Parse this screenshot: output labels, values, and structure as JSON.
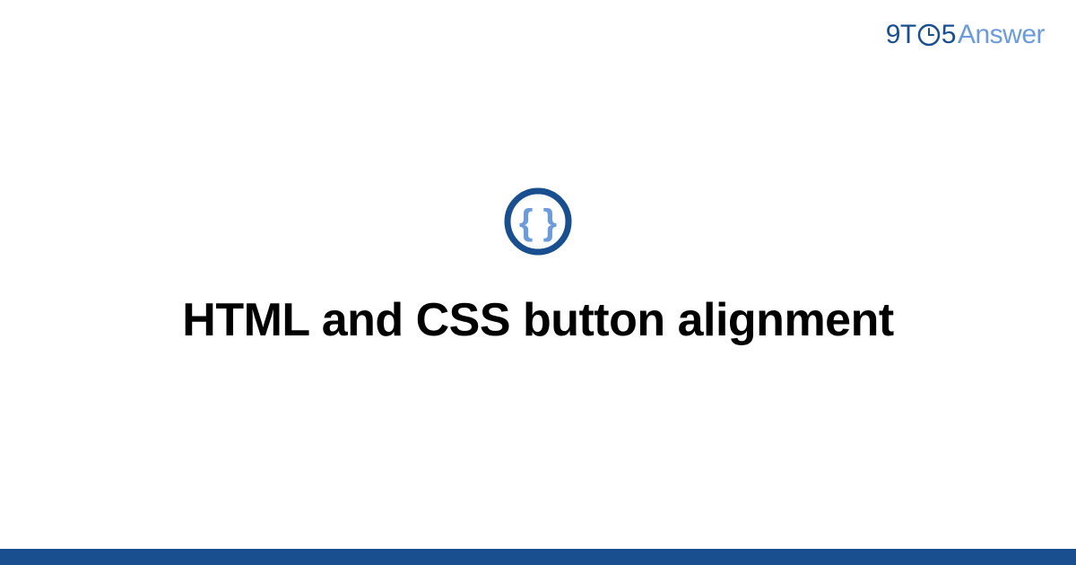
{
  "header": {
    "logo": {
      "part1": "9T",
      "part2": "5",
      "part3": "Answer"
    }
  },
  "main": {
    "title": "HTML and CSS button alignment"
  },
  "colors": {
    "primary_dark": "#1a4f8f",
    "primary_light": "#6b9bd8",
    "text": "#000000",
    "background": "#ffffff"
  }
}
